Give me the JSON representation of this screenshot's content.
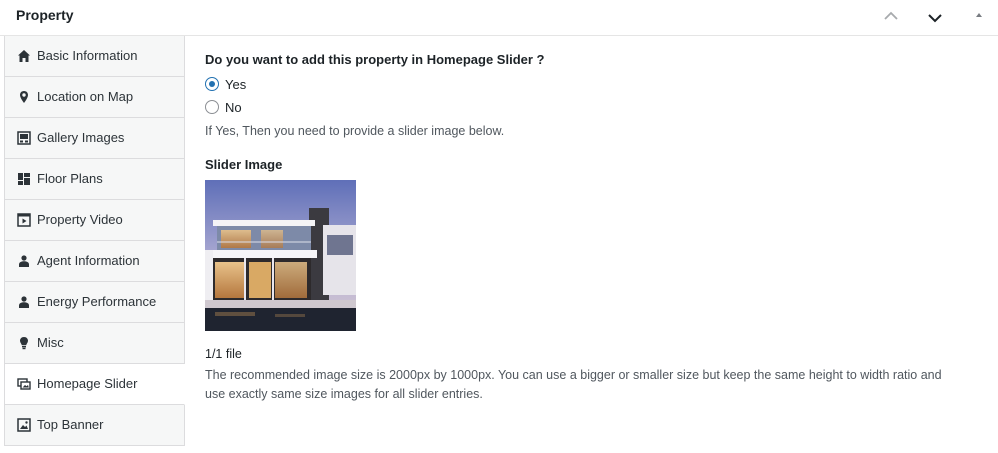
{
  "header": {
    "title": "Property",
    "controls": [
      "chevron-up-icon",
      "chevron-down-icon",
      "caret-up-icon"
    ]
  },
  "sidebar": {
    "active_index": 8,
    "tabs": [
      {
        "label": "Basic Information",
        "icon": "home-icon"
      },
      {
        "label": "Location on Map",
        "icon": "map-pin-icon"
      },
      {
        "label": "Gallery Images",
        "icon": "images-icon"
      },
      {
        "label": "Floor Plans",
        "icon": "floor-plan-icon"
      },
      {
        "label": "Property Video",
        "icon": "video-icon"
      },
      {
        "label": "Agent Information",
        "icon": "user-icon"
      },
      {
        "label": "Energy Performance",
        "icon": "user-icon"
      },
      {
        "label": "Misc",
        "icon": "lightbulb-icon"
      },
      {
        "label": "Homepage Slider",
        "icon": "slides-icon"
      },
      {
        "label": "Top Banner",
        "icon": "image-icon"
      }
    ]
  },
  "main": {
    "question": "Do you want to add this property in Homepage Slider ?",
    "options": [
      {
        "label": "Yes",
        "checked": true
      },
      {
        "label": "No",
        "checked": false
      }
    ],
    "hint": "If Yes, Then you need to provide a slider image below.",
    "slider_label": "Slider Image",
    "file_count": "1/1 file",
    "note": "The recommended image size is 2000px by 1000px. You can use a bigger or smaller size but keep the same height to width ratio and use exactly same size images for all slider entries."
  },
  "colors": {
    "accent": "#2271b1",
    "sidebar_bg": "#f6f7f7",
    "border": "#dcdcde"
  }
}
